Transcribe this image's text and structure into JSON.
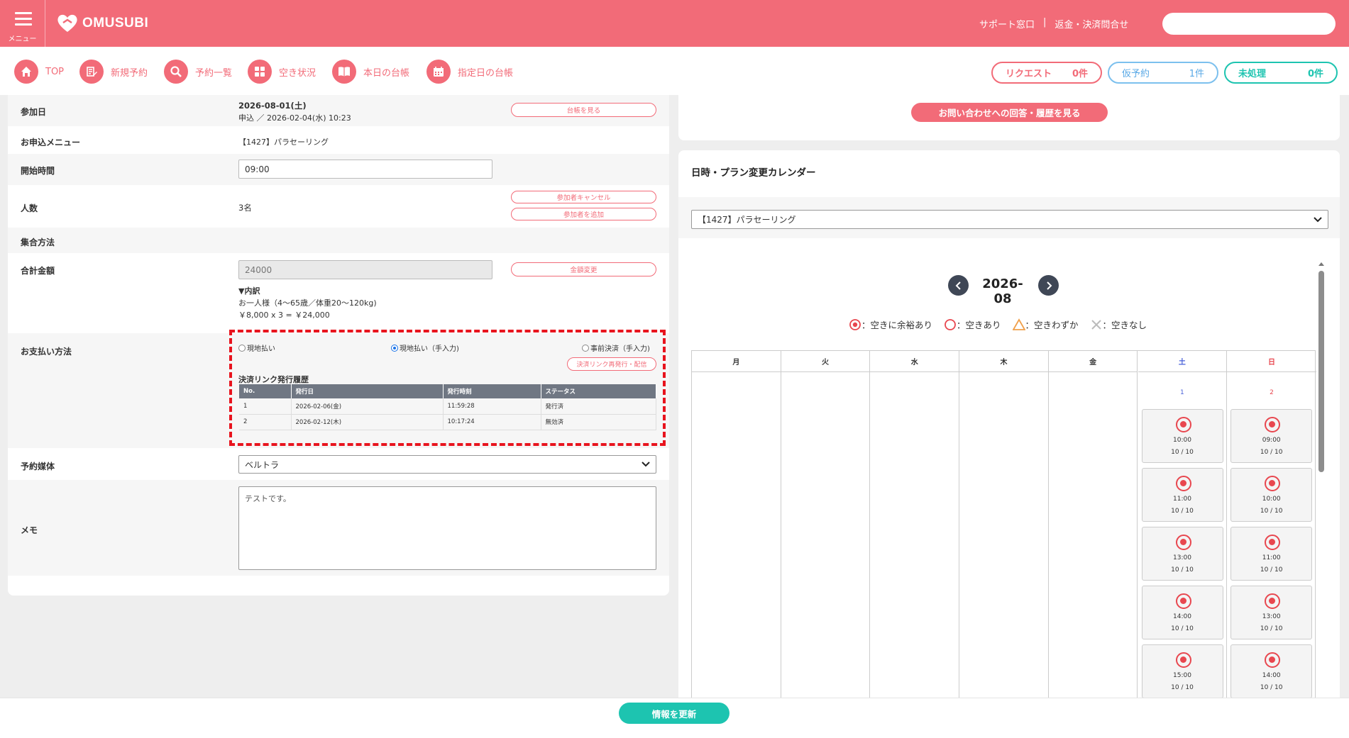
{
  "header": {
    "menu_label": "メニュー",
    "logo_text": "OMUSUBI",
    "support_link": "サポート窓口",
    "separator": "|",
    "refund_link": "返金・決済問合せ",
    "search_placeholder": ""
  },
  "nav": [
    {
      "label": "TOP",
      "icon": "home-icon"
    },
    {
      "label": "新規予約",
      "icon": "edit-icon"
    },
    {
      "label": "予約一覧",
      "icon": "search-icon"
    },
    {
      "label": "空き状況",
      "icon": "grid-icon"
    },
    {
      "label": "本日の台帳",
      "icon": "book-icon"
    },
    {
      "label": "指定日の台帳",
      "icon": "calendar-icon"
    }
  ],
  "counters": [
    {
      "label": "リクエスト",
      "count": "0件",
      "color": "#f26b78"
    },
    {
      "label": "仮予約",
      "count": "1件",
      "color": "#5aa9e6"
    },
    {
      "label": "未処理",
      "count": "0件",
      "color": "#1dc4b0"
    }
  ],
  "form": {
    "participation_date_label": "参加日",
    "participation_date": "2026-08-01(土)",
    "application_info": "申込 ／ 2026-02-04(水) 10:23",
    "ledger_button": "台帳を見る",
    "menu_label": "お申込メニュー",
    "menu_value": "【1427】パラセーリング",
    "start_time_label": "開始時間",
    "start_time_value": "09:00",
    "people_label": "人数",
    "people_value": "3名",
    "cancel_participant_button": "参加者キャンセル",
    "add_participant_button": "参加者を追加",
    "meeting_label": "集合方法",
    "total_label": "合計金額",
    "total_value": "24000",
    "change_amount_button": "金額変更",
    "breakdown_title": "▼内訳",
    "breakdown_line1": "お一人様（4〜65歳／体重20〜120kg)",
    "breakdown_line2": "￥8,000 x 3 = ￥24,000",
    "payment_label": "お支払い方法",
    "payment_options": [
      "現地払い",
      "現地払い（手入力)",
      "事前決済（手入力)"
    ],
    "reissue_link_button": "決済リンク再発行・配信",
    "history_title": "決済リンク発行履歴",
    "history_headers": [
      "No.",
      "発行日",
      "発行時刻",
      "ステータス"
    ],
    "history_rows": [
      [
        "1",
        "2026-02-06(金)",
        "11:59:28",
        "発行済"
      ],
      [
        "2",
        "2026-02-12(木)",
        "10:17:24",
        "無効済"
      ]
    ],
    "media_label": "予約媒体",
    "media_value": "ベルトラ",
    "memo_label": "メモ",
    "memo_value": "テストです。"
  },
  "right": {
    "inquiry_button": "お問い合わせへの回答・履歴を見る",
    "calendar_title": "日時・プラン変更カレンダー",
    "plan_select": "【1427】パラセーリング",
    "month": "2026-08",
    "legend": [
      "：空きに余裕あり",
      "：空きあり",
      "：空きわずか",
      "：空きなし"
    ],
    "weekdays": [
      "月",
      "火",
      "水",
      "木",
      "金",
      "土",
      "日"
    ],
    "sat_day": "1",
    "sun_day": "2",
    "sat_slots": [
      {
        "time": "10:00",
        "cap": "10 / 10"
      },
      {
        "time": "11:00",
        "cap": "10 / 10"
      },
      {
        "time": "13:00",
        "cap": "10 / 10"
      },
      {
        "time": "14:00",
        "cap": "10 / 10"
      },
      {
        "time": "15:00",
        "cap": "10 / 10"
      }
    ],
    "sun_slots": [
      {
        "time": "09:00",
        "cap": "10 / 10"
      },
      {
        "time": "10:00",
        "cap": "10 / 10"
      },
      {
        "time": "11:00",
        "cap": "10 / 10"
      },
      {
        "time": "13:00",
        "cap": "10 / 10"
      },
      {
        "time": "14:00",
        "cap": "10 / 10"
      }
    ]
  },
  "footer": {
    "update_button": "情報を更新"
  },
  "colors": {
    "brand": "#f26b78",
    "accent_teal": "#1dc4b0",
    "highlight_dash": "#e8141e",
    "saturday": "#4a62d8",
    "sunday": "#e8474f"
  }
}
